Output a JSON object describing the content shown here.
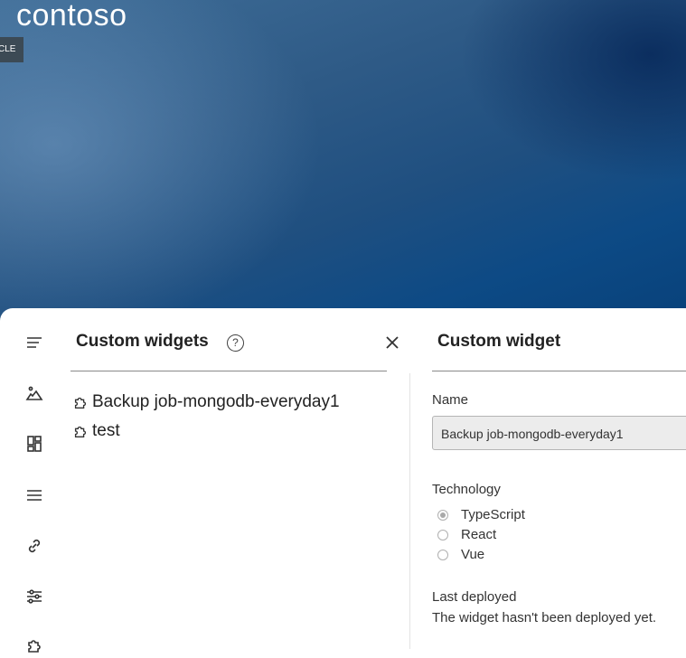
{
  "brand": {
    "logo_text": "contoso",
    "badge_text": "CLE"
  },
  "rail": {
    "icons": [
      "menu-icon",
      "image-icon",
      "dashboard-icon",
      "list-icon",
      "link-icon",
      "sliders-icon",
      "puzzle-icon"
    ]
  },
  "widgets_panel": {
    "title": "Custom widgets",
    "help_glyph": "?",
    "items": [
      {
        "label": "Backup job-mongodb-everyday1"
      },
      {
        "label": "test"
      }
    ]
  },
  "detail_panel": {
    "title": "Custom widget",
    "name_label": "Name",
    "name_value": "Backup job-mongodb-everyday1",
    "technology_label": "Technology",
    "technology_options": [
      {
        "label": "TypeScript",
        "selected": true
      },
      {
        "label": "React",
        "selected": false
      },
      {
        "label": "Vue",
        "selected": false
      }
    ],
    "last_deployed_label": "Last deployed",
    "last_deployed_value": "The widget hasn't been deployed yet."
  },
  "colors": {
    "hero_dark": "#0d4a85",
    "hero_light": "#4f7ea8",
    "panel_bg": "#ffffff"
  }
}
